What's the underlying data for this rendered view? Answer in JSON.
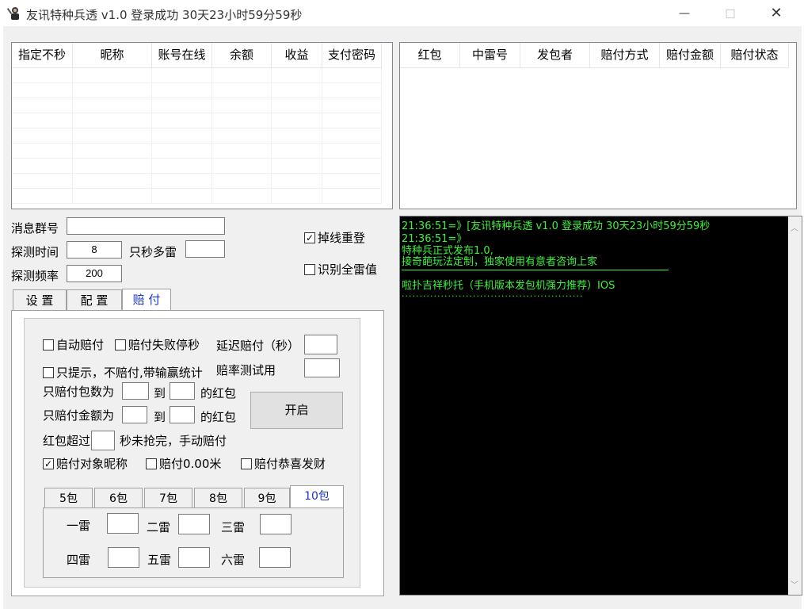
{
  "window": {
    "title": "友讯特种兵透 v1.0 登录成功 30天23小时59分59秒",
    "minimize": "—",
    "maximize": "□",
    "close": "✕"
  },
  "account_table": {
    "columns": [
      "指定不秒",
      "昵称",
      "账号在线",
      "余额",
      "收益",
      "支付密码"
    ]
  },
  "redpacket_table": {
    "columns": [
      "红包",
      "中雷号",
      "发包者",
      "赔付方式",
      "赔付金额",
      "赔付状态"
    ]
  },
  "settings": {
    "group_label": "消息群号",
    "group_value": "",
    "detect_time_label": "探测时间",
    "detect_time_value": "8",
    "multi_mine_label": "只秒多雷",
    "multi_mine_value": "",
    "detect_freq_label": "探测频率",
    "detect_freq_value": "200",
    "reconnect_label": "掉线重登",
    "reconnect_checked": true,
    "identify_all_label": "识别全雷值",
    "identify_all_checked": false
  },
  "tabs": [
    "设 置",
    "配 置",
    "赔 付"
  ],
  "active_tab": "赔 付",
  "payout": {
    "auto_pay_label": "自动赔付",
    "stop_on_fail_label": "赔付失败停秒",
    "delay_label": "延迟赔付（秒）",
    "delay_value": "",
    "hint_only_label": "只提示，不赔付,带输赢统计",
    "rate_label": "赔率测试用",
    "rate_value": "",
    "count_prefix": "只赔付包数为",
    "count_to": "到",
    "count_suffix": "的红包",
    "amount_prefix": "只赔付金额为",
    "amount_to": "到",
    "amount_suffix": "的红包",
    "start_button": "开启",
    "over_prefix": "红包超过",
    "over_suffix": "秒未抢完，手动赔付",
    "nickname_label": "赔付对象昵称",
    "nickname_checked": true,
    "zero_label": "赔付0.00米",
    "congrats_label": "赔付恭喜发财"
  },
  "packet_tabs": [
    "5包",
    "6包",
    "7包",
    "8包",
    "9包",
    "10包"
  ],
  "active_packet_tab": "10包",
  "mines": [
    "一雷",
    "二雷",
    "三雷",
    "四雷",
    "五雷",
    "六雷"
  ],
  "console": {
    "lines": [
      "21:36:51=》[友讯特种兵透 v1.0 登录成功 30天23小时59分59秒",
      "21:36:51=》",
      "特种兵正式发布1.0,",
      "接奇葩玩法定制，独家使用有意者咨询上家",
      "啦扑吉祥秒托（手机版本发包机强力推荐）IOS",
      "..................................................."
    ],
    "text_color": "#3df23d"
  }
}
